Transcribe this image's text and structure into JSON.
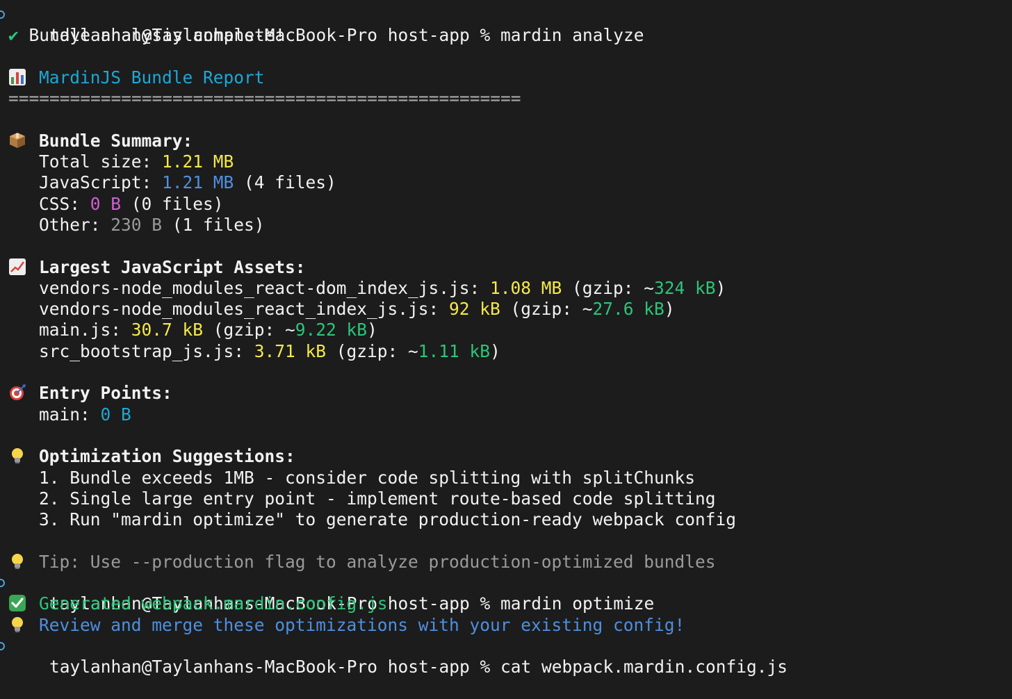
{
  "session": {
    "prompt": "taylanhan@Taylanhans-MacBook-Pro host-app % ",
    "cmd1": "mardin analyze",
    "cmd2": "mardin optimize",
    "cmd3": "cat webpack.mardin.config.js"
  },
  "analysis": {
    "complete": "Bundle analysis complete!",
    "report_title": "MardinJS Bundle Report",
    "rule": "==================================================",
    "summary": {
      "heading": "Bundle Summary:",
      "total_label": "Total size: ",
      "total_value": "1.21 MB",
      "js_label": "JavaScript: ",
      "js_value": "1.21 MB",
      "js_files": " (4 files)",
      "css_label": "CSS: ",
      "css_value": "0 B",
      "css_files": " (0 files)",
      "other_label": "Other: ",
      "other_value": "230 B",
      "other_files": " (1 files)"
    },
    "assets": {
      "heading": "Largest JavaScript Assets:",
      "items": [
        {
          "name": "vendors-node_modules_react-dom_index_js.js: ",
          "size": "1.08 MB",
          "gzip_label": " (gzip: ~",
          "gzip": "324 kB",
          "close": ")"
        },
        {
          "name": "vendors-node_modules_react_index_js.js: ",
          "size": "92 kB",
          "gzip_label": " (gzip: ~",
          "gzip": "27.6 kB",
          "close": ")"
        },
        {
          "name": "main.js: ",
          "size": "30.7 kB",
          "gzip_label": " (gzip: ~",
          "gzip": "9.22 kB",
          "close": ")"
        },
        {
          "name": "src_bootstrap_js.js: ",
          "size": "3.71 kB",
          "gzip_label": " (gzip: ~",
          "gzip": "1.11 kB",
          "close": ")"
        }
      ]
    },
    "entry": {
      "heading": "Entry Points:",
      "label": "main: ",
      "value": "0 B"
    },
    "suggestions": {
      "heading": "Optimization Suggestions:",
      "items": [
        "1. Bundle exceeds 1MB - consider code splitting with splitChunks",
        "2. Single large entry point - implement route-based code splitting",
        "3. Run \"mardin optimize\" to generate production-ready webpack config"
      ]
    },
    "tip": "Tip: Use --production flag to analyze production-optimized bundles"
  },
  "optimize": {
    "generated": "Generated webpack.mardin.config.js",
    "review": "Review and merge these optimizations with your existing config!"
  },
  "icons": {
    "check": "checkmark-icon",
    "chart": "bar-chart-icon",
    "package": "package-icon",
    "trend": "chart-increasing-icon",
    "target": "target-icon",
    "bulb": "light-bulb-icon",
    "check_box": "check-box-icon"
  },
  "colors": {
    "background": "#1c1c1c",
    "text": "#f2f2f2",
    "yellow": "#f5e94a",
    "blue": "#4f8fe0",
    "magenta": "#d15fd6",
    "green": "#2cc57a",
    "cyan": "#1ea7d6"
  }
}
